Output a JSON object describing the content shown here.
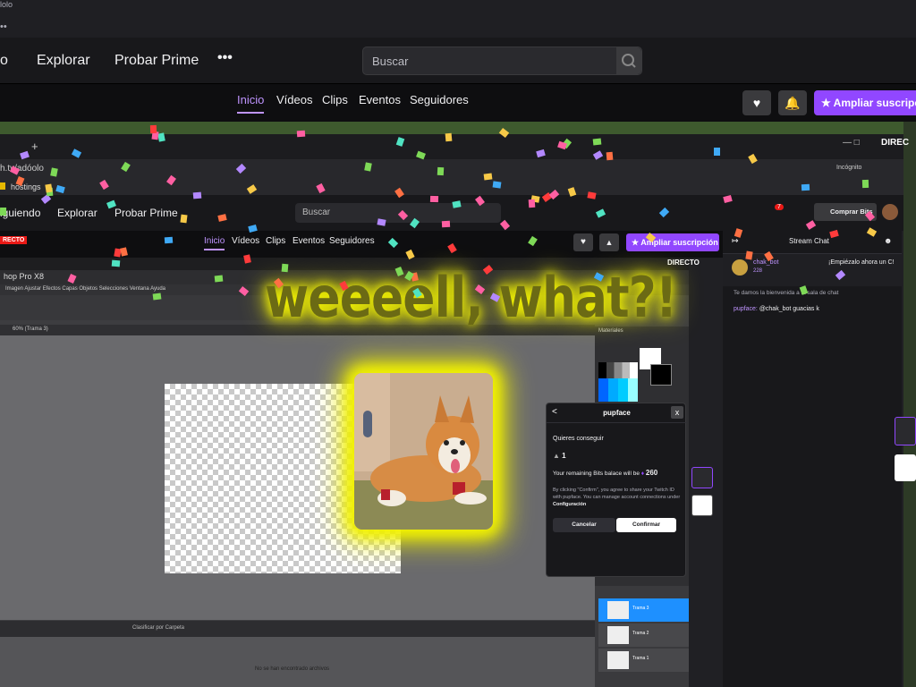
{
  "os_strip": {
    "title_fragment": "lolo",
    "dots": "••"
  },
  "topnav": {
    "partial_left": "o",
    "explore": "Explorar",
    "prime": "Probar Prime",
    "more": "•••",
    "search_placeholder": "Buscar"
  },
  "tabs": [
    "Inicio",
    "Vídeos",
    "Clips",
    "Eventos",
    "Seguidores"
  ],
  "actions": {
    "subscribe": "Ampliar suscripción"
  },
  "outer_live_badge": "DIREC",
  "inner_browser": {
    "url": "h.tv/adóolo",
    "bookmark": "hostings",
    "incognito": "Incógnito",
    "nav_following": "iguiendo",
    "nav_explore": "Explorar",
    "nav_prime": "Probar Prime",
    "search_placeholder": "Buscar",
    "buy_bits": "Comprar Bits",
    "notif_count": "7",
    "live_badge": "RECTO",
    "tabs": [
      "Inicio",
      "Vídeos",
      "Clips",
      "Eventos",
      "Seguidores"
    ],
    "subscribe": "Ampliar suscripción",
    "direct": "DIRECTO"
  },
  "psp": {
    "title": "hop Pro X8",
    "menu": "Imagen   Ajustar   Efectos   Capas   Objetos   Selecciones   Ventana   Ayuda",
    "tab": "60% (Trama 3)",
    "materials_title": "Materiales",
    "status_text": "No se han encontrado archivos",
    "bottom_tools": "Clasificar por     Carpeta",
    "layers": [
      "Trama 3",
      "Trama 2",
      "Trama 1"
    ]
  },
  "meme_caption": "weeeell, what?!",
  "bits_popup": {
    "title": "pupface",
    "back": "<",
    "close": "x",
    "question": "Quieres conseguir",
    "amount": "1",
    "remaining_prefix": "Your remaining Bits balace will be",
    "remaining_value": "260",
    "legal": "By clicking \"Confirm\", you agree to share your Twitch ID with pupface. You can manage account connections under",
    "legal_link": "Configuración",
    "cancel": "Cancelar",
    "confirm": "Confirmar"
  },
  "inner_chat": {
    "header": "Stream Chat",
    "pinned_user": "chak_bot",
    "pinned_badge": "228",
    "pinned_text": "¡Empiézalo ahora un C!",
    "welcome": "Te damos la bienvenida a la sala de chat",
    "msg_user": "pupface:",
    "msg_text": "@chak_bot guacias k"
  }
}
